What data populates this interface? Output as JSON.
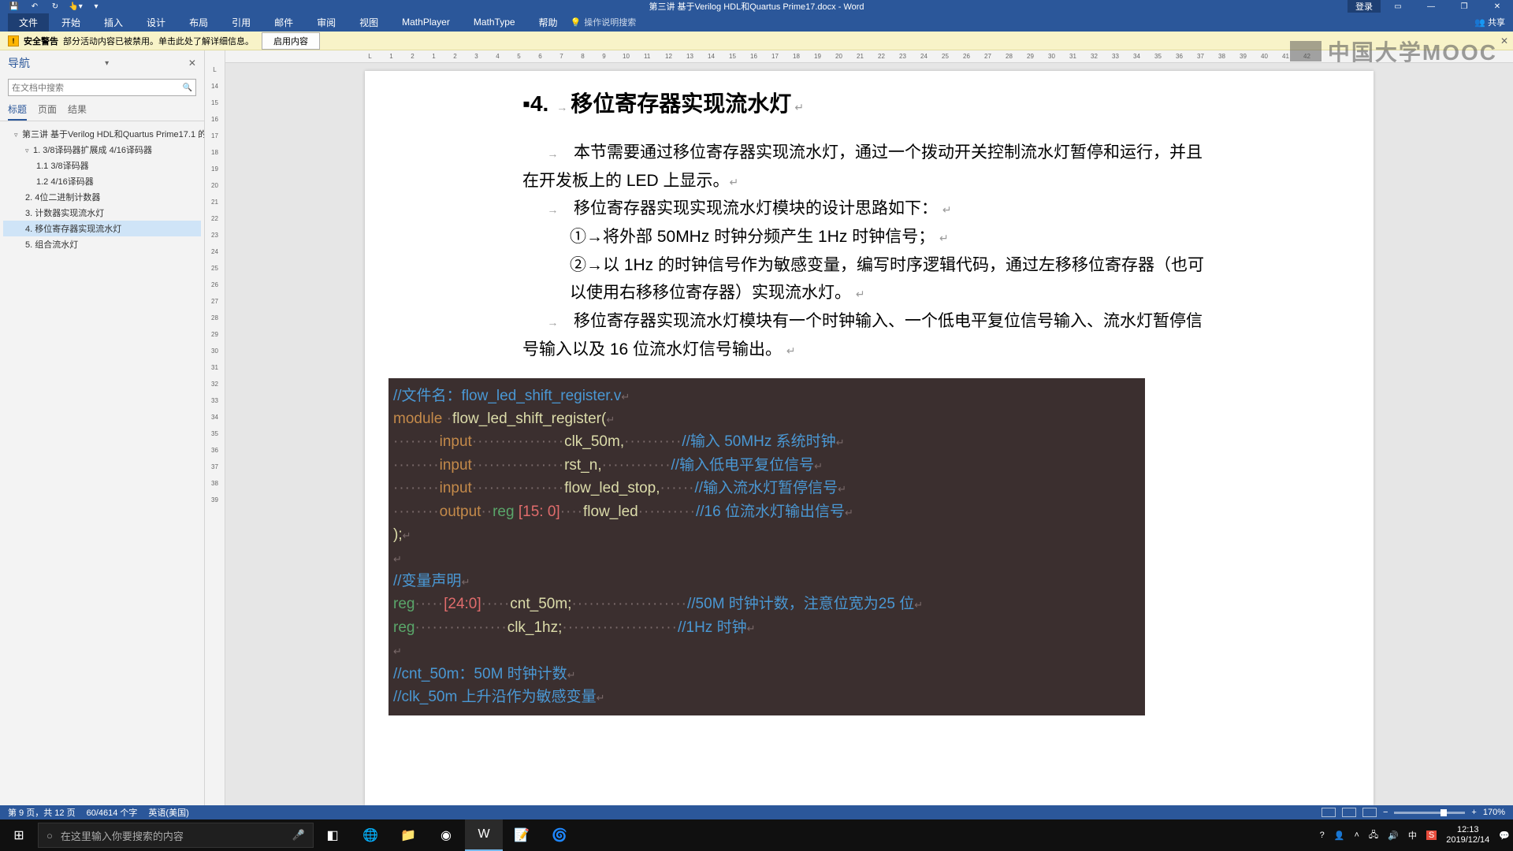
{
  "titlebar": {
    "doc_title": "第三讲 基于Verilog HDL和Quartus Prime17.docx - Word",
    "signin": "登录"
  },
  "ribbon": {
    "file": "文件",
    "home": "开始",
    "insert": "插入",
    "design": "设计",
    "layout": "布局",
    "references": "引用",
    "mailings": "邮件",
    "review": "审阅",
    "view": "视图",
    "mathplayer": "MathPlayer",
    "mathtype": "MathType",
    "help": "帮助",
    "tell_me": "操作说明搜索",
    "share": "共享"
  },
  "security": {
    "label": "安全警告",
    "msg": "部分活动内容已被禁用。单击此处了解详细信息。",
    "enable": "启用内容"
  },
  "mooc": "中国大学MOOC",
  "nav": {
    "title": "导航",
    "search_placeholder": "在文档中搜索",
    "tab_headings": "标题",
    "tab_pages": "页面",
    "tab_results": "结果",
    "tree": {
      "root": "第三讲 基于Verilog HDL和Quartus Prime17.1 的...",
      "n1": "1. 3/8译码器扩展成 4/16译码器",
      "n1_1": "1.1 3/8译码器",
      "n1_2": "1.2 4/16译码器",
      "n2": "2. 4位二进制计数器",
      "n3": "3. 计数器实现流水灯",
      "n4": "4. 移位寄存器实现流水灯",
      "n5": "5. 组合流水灯"
    }
  },
  "doc": {
    "heading_num": "4.",
    "heading_text": "移位寄存器实现流水灯",
    "p1": "本节需要通过移位寄存器实现流水灯，通过一个拨动开关控制流水灯暂停和运行，并且在开发板上的 LED 上显示。",
    "p2": "移位寄存器实现实现流水灯模块的设计思路如下：",
    "p3": "①→将外部 50MHz 时钟分频产生 1Hz 时钟信号；",
    "p4": "②→以 1Hz 的时钟信号作为敏感变量，编写时序逻辑代码，通过左移移位寄存器（也可以使用右移移位寄存器）实现流水灯。",
    "p5": "移位寄存器实现流水灯模块有一个时钟输入、一个低电平复位信号输入、流水灯暂停信号输入以及 16 位流水灯信号输出。"
  },
  "code": {
    "l1_cmt": "//文件名：flow_led_shift_register.v",
    "l2_kw": "module",
    "l2_id": "flow_led_shift_register",
    "l3_kw": "input",
    "l3_id": "clk_50m",
    "l3_cmt": "//输入 50MHz 系统时钟",
    "l4_kw": "input",
    "l4_id": "rst_n",
    "l4_cmt": "//输入低电平复位信号",
    "l5_kw": "input",
    "l5_id": "flow_led_stop",
    "l5_cmt": "//输入流水灯暂停信号",
    "l6_kw1": "output",
    "l6_kw2": "reg",
    "l6_rng": "[15: 0]",
    "l6_id": "flow_led",
    "l6_cmt": "//16 位流水灯输出信号",
    "l7": ");",
    "l8_cmt": "//变量声明",
    "l9_kw": "reg",
    "l9_rng": "[24:0]",
    "l9_id": "cnt_50m;",
    "l9_cmt": "//50M 时钟计数，注意位宽为25 位",
    "l10_kw": "reg",
    "l10_id": "clk_1hz;",
    "l10_cmt": "//1Hz 时钟",
    "l11_cmt": "//cnt_50m：50M 时钟计数",
    "l12_cmt": "//clk_50m 上升沿作为敏感变量"
  },
  "status": {
    "page": "第 9 页，共 12 页",
    "words": "60/4614 个字",
    "lang": "英语(美国)",
    "zoom": "170%"
  },
  "taskbar": {
    "search_placeholder": "在这里输入你要搜索的内容",
    "time": "12:13",
    "date": "2019/12/14"
  },
  "hruler_marks": [
    "L",
    "1",
    "2",
    "1",
    "2",
    "3",
    "4",
    "5",
    "6",
    "7",
    "8",
    "9",
    "10",
    "11",
    "12",
    "13",
    "14",
    "15",
    "16",
    "17",
    "18",
    "19",
    "20",
    "21",
    "22",
    "23",
    "24",
    "25",
    "26",
    "27",
    "28",
    "29",
    "30",
    "31",
    "32",
    "33",
    "34",
    "35",
    "36",
    "37",
    "38",
    "39",
    "40",
    "41",
    "42"
  ],
  "vruler_marks": [
    "L",
    "14",
    "15",
    "16",
    "17",
    "18",
    "19",
    "20",
    "21",
    "22",
    "23",
    "24",
    "25",
    "26",
    "27",
    "28",
    "29",
    "30",
    "31",
    "32",
    "33",
    "34",
    "35",
    "36",
    "37",
    "38",
    "39"
  ]
}
